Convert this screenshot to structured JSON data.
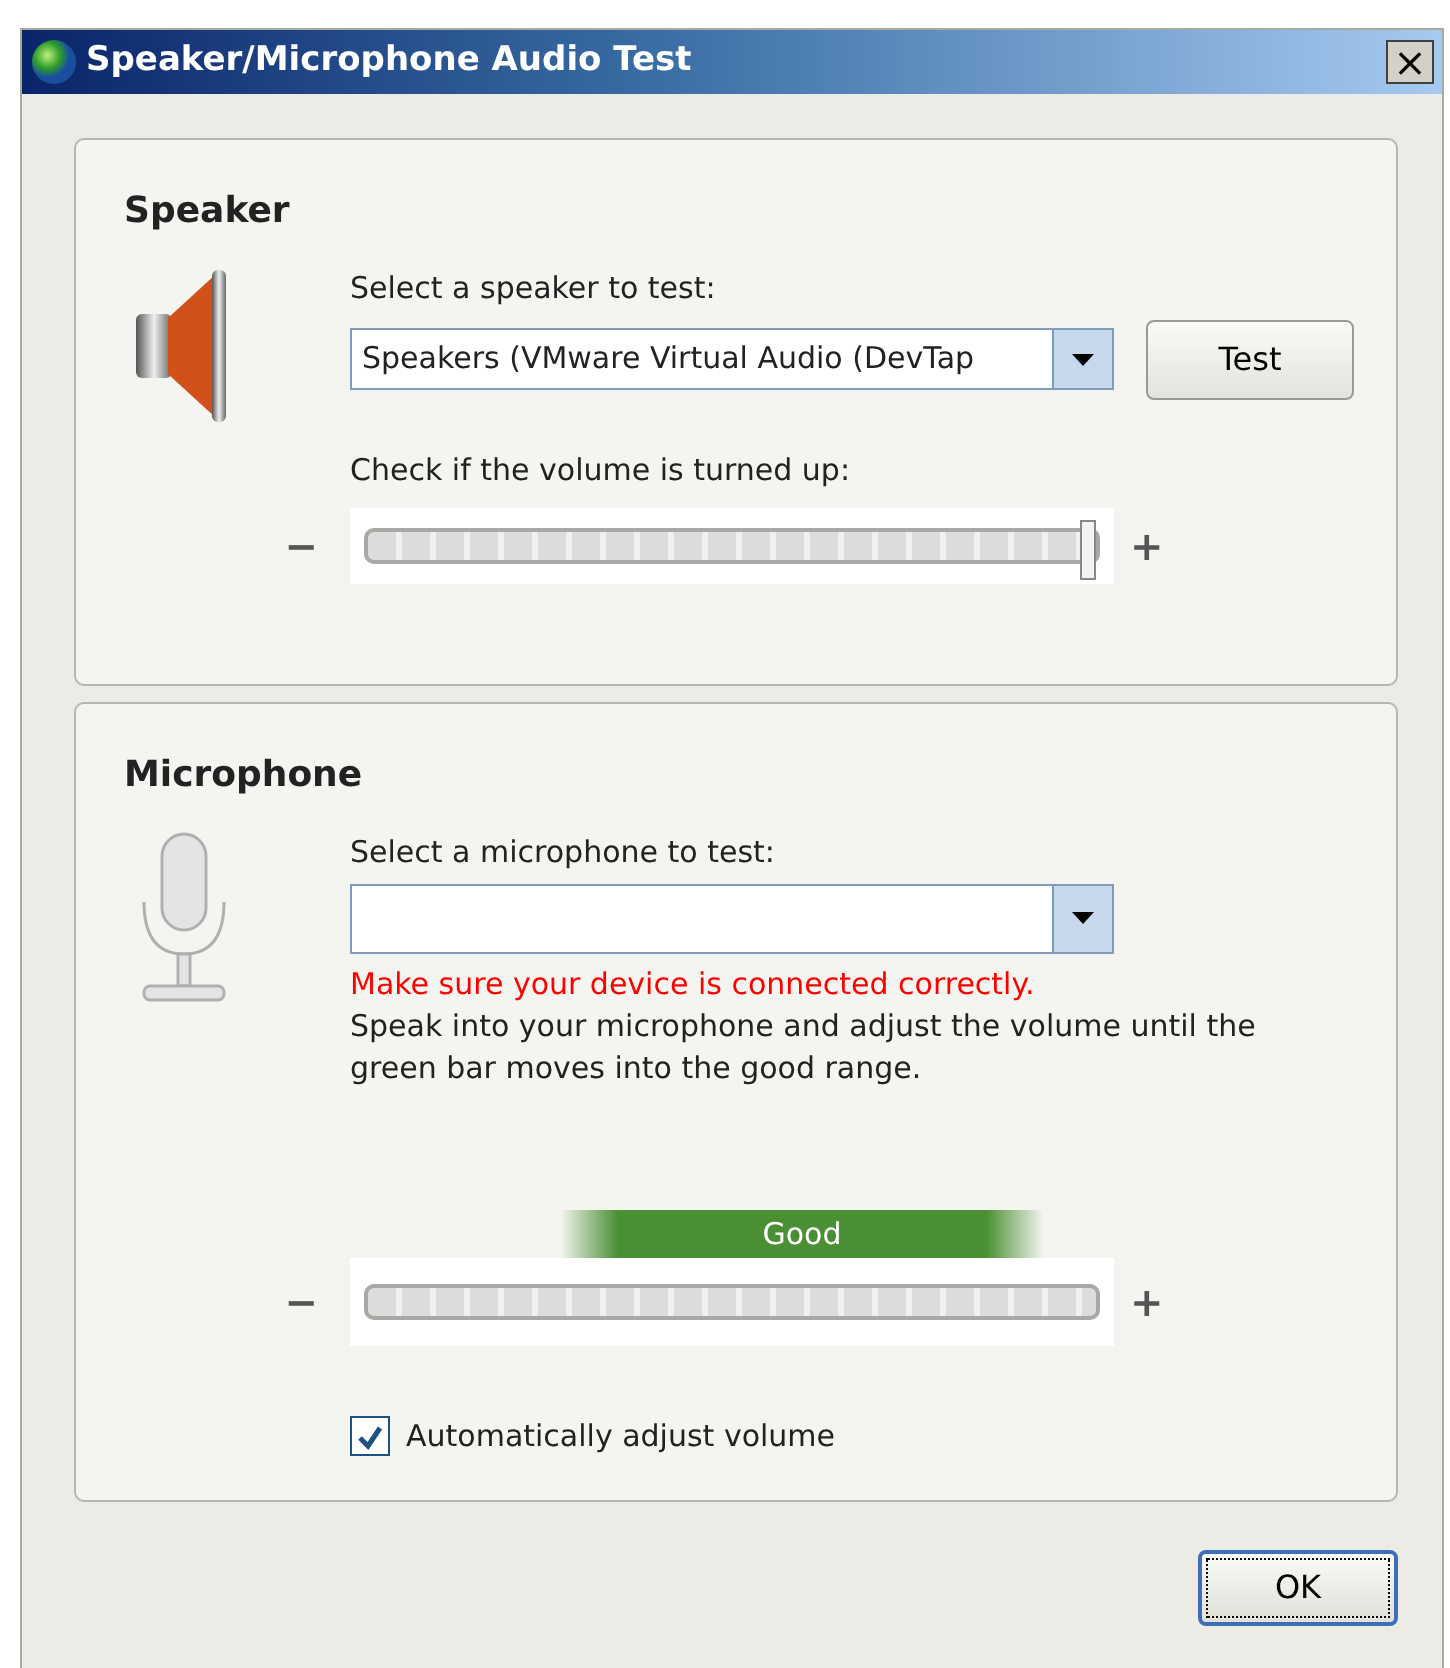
{
  "window": {
    "title": "Speaker/Microphone Audio Test",
    "close": "×"
  },
  "speaker": {
    "heading": "Speaker",
    "select_label": "Select a speaker to test:",
    "device": "Speakers (VMware Virtual Audio (DevTap",
    "test_button": "Test",
    "volume_label": "Check if the volume is turned up:",
    "volume": {
      "minus": "−",
      "plus": "+",
      "level": 1
    }
  },
  "microphone": {
    "heading": "Microphone",
    "select_label": "Select a microphone to test:",
    "error": "Make sure your device is connected correctly.",
    "instructions": "Speak into your microphone and adjust the volume until the green bar moves into the good range.",
    "good_label": "Good",
    "meter": {
      "minus": "−",
      "plus": "+",
      "level": 0
    },
    "auto_adjust": {
      "label": "Automatically adjust volume",
      "checked": true
    }
  },
  "buttons": [
    "OK"
  ]
}
